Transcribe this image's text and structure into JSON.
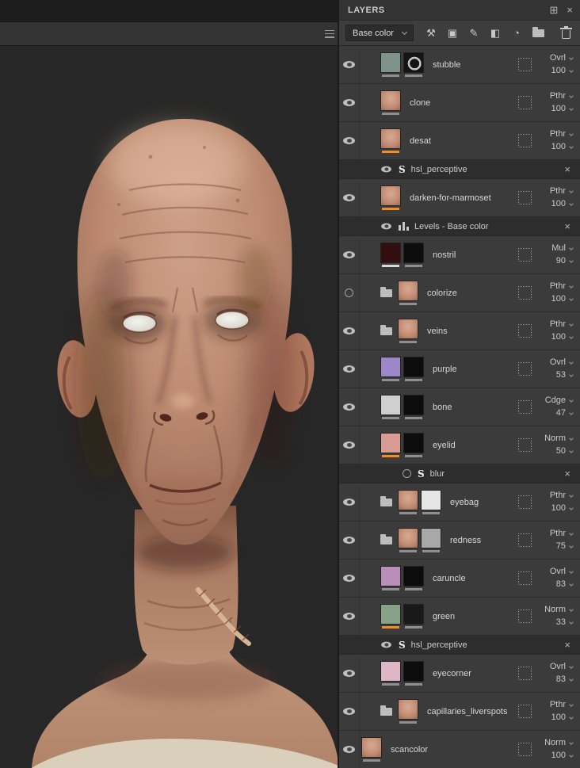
{
  "colors": {
    "accent_orange": "#f08d24",
    "panel_bg": "#333333",
    "row_bg": "#3b3b3b",
    "viewport_bg": "#272727",
    "skin_tone": "#bd8c72"
  },
  "viewport": {
    "background": "#272727"
  },
  "panel": {
    "title": "LAYERS",
    "header_icons": {
      "dock": "⊞",
      "close": "×"
    },
    "toolbar": {
      "channel": "Base color",
      "tools": [
        {
          "name": "add-effect-icon",
          "glyph": "⚒"
        },
        {
          "name": "add-geometry-mask-icon",
          "glyph": "▣"
        },
        {
          "name": "add-paint-layer-icon",
          "glyph": "✎"
        },
        {
          "name": "add-fill-layer-icon",
          "glyph": "◧"
        },
        {
          "name": "add-smart-mask-icon",
          "glyph": "◔"
        },
        {
          "name": "add-folder-icon",
          "glyph": "folder"
        },
        {
          "name": "delete-layer-icon",
          "glyph": "trash"
        }
      ]
    },
    "effect_close_glyph": "×",
    "rows": [
      {
        "kind": "layer",
        "name": "stubble",
        "visible": true,
        "folder": false,
        "indent": 1,
        "thumbs": [
          {
            "color": "#7e948a"
          },
          {
            "color": "#161616",
            "detail": "ring"
          }
        ],
        "blend": "Ovrl",
        "opacity": "100"
      },
      {
        "kind": "layer",
        "name": "clone",
        "visible": true,
        "folder": false,
        "indent": 1,
        "thumbs": [
          {
            "skin": true
          }
        ],
        "blend": "Pthr",
        "opacity": "100"
      },
      {
        "kind": "layer",
        "name": "desat",
        "visible": true,
        "folder": false,
        "indent": 1,
        "thumbs": [
          {
            "skin": true,
            "underline": "#f08d24"
          }
        ],
        "blend": "Pthr",
        "opacity": "100"
      },
      {
        "kind": "effect",
        "name": "hsl_perceptive",
        "icon": "substance",
        "visible": true,
        "indent": 1
      },
      {
        "kind": "layer",
        "name": "darken-for-marmoset",
        "visible": true,
        "folder": false,
        "indent": 1,
        "thumbs": [
          {
            "skin": true,
            "underline": "#f08d24"
          }
        ],
        "blend": "Pthr",
        "opacity": "100"
      },
      {
        "kind": "effect",
        "name": "Levels - Base color",
        "icon": "levels",
        "visible": true,
        "indent": 1
      },
      {
        "kind": "layer",
        "name": "nostril",
        "visible": true,
        "folder": false,
        "indent": 1,
        "thumbs": [
          {
            "color": "#320e0e",
            "underline": "#d8d8d8"
          },
          {
            "color": "#0d0d0d"
          }
        ],
        "blend": "Mul",
        "opacity": "90"
      },
      {
        "kind": "layer",
        "name": "colorize",
        "visible": false,
        "folder": true,
        "indent": 1,
        "thumbs": [
          {
            "skin": true
          }
        ],
        "blend": "Pthr",
        "opacity": "100"
      },
      {
        "kind": "layer",
        "name": "veins",
        "visible": true,
        "folder": true,
        "indent": 1,
        "thumbs": [
          {
            "skin": true
          }
        ],
        "blend": "Pthr",
        "opacity": "100"
      },
      {
        "kind": "layer",
        "name": "purple",
        "visible": true,
        "folder": false,
        "indent": 1,
        "thumbs": [
          {
            "color": "#9d87c9"
          },
          {
            "color": "#0c0c0c"
          }
        ],
        "blend": "Ovrl",
        "opacity": "53"
      },
      {
        "kind": "layer",
        "name": "bone",
        "visible": true,
        "folder": false,
        "indent": 1,
        "thumbs": [
          {
            "color": "#cfcfcf"
          },
          {
            "color": "#0c0c0c"
          }
        ],
        "blend": "Cdge",
        "opacity": "47"
      },
      {
        "kind": "layer",
        "name": "eyelid",
        "visible": true,
        "folder": false,
        "indent": 1,
        "thumbs": [
          {
            "color": "#d99c94",
            "underline": "#f08d24"
          },
          {
            "color": "#0c0c0c"
          }
        ],
        "blend": "Norm",
        "opacity": "50"
      },
      {
        "kind": "effect",
        "name": "blur",
        "icon": "substance",
        "visible": false,
        "indent": 2
      },
      {
        "kind": "layer",
        "name": "eyebag",
        "visible": true,
        "folder": true,
        "indent": 1,
        "thumbs": [
          {
            "skin": true
          },
          {
            "color": "#e6e6e6"
          }
        ],
        "blend": "Pthr",
        "opacity": "100"
      },
      {
        "kind": "layer",
        "name": "redness",
        "visible": true,
        "folder": true,
        "indent": 1,
        "thumbs": [
          {
            "skin": true
          },
          {
            "color": "#a8a8a8"
          }
        ],
        "blend": "Pthr",
        "opacity": "75"
      },
      {
        "kind": "layer",
        "name": "caruncle",
        "visible": true,
        "folder": false,
        "indent": 1,
        "thumbs": [
          {
            "color": "#b98fb9"
          },
          {
            "color": "#0c0c0c"
          }
        ],
        "blend": "Ovrl",
        "opacity": "83"
      },
      {
        "kind": "layer",
        "name": "green",
        "visible": true,
        "folder": false,
        "indent": 1,
        "thumbs": [
          {
            "color": "#87a287",
            "underline": "#f08d24"
          },
          {
            "color": "#191919"
          }
        ],
        "blend": "Norm",
        "opacity": "33"
      },
      {
        "kind": "effect",
        "name": "hsl_perceptive",
        "icon": "substance",
        "visible": true,
        "indent": 1
      },
      {
        "kind": "layer",
        "name": "eyecorner",
        "visible": true,
        "folder": false,
        "indent": 1,
        "thumbs": [
          {
            "color": "#dfb6c6"
          },
          {
            "color": "#0c0c0c"
          }
        ],
        "blend": "Ovrl",
        "opacity": "83"
      },
      {
        "kind": "layer",
        "name": "capillaries_liverspots",
        "visible": true,
        "folder": true,
        "indent": 1,
        "thumbs": [
          {
            "skin": true
          }
        ],
        "blend": "Pthr",
        "opacity": "100"
      },
      {
        "kind": "layer",
        "name": "scancolor",
        "visible": true,
        "folder": false,
        "indent": 0,
        "thumbs": [
          {
            "skin": true
          }
        ],
        "blend": "Norm",
        "opacity": "100"
      }
    ]
  }
}
